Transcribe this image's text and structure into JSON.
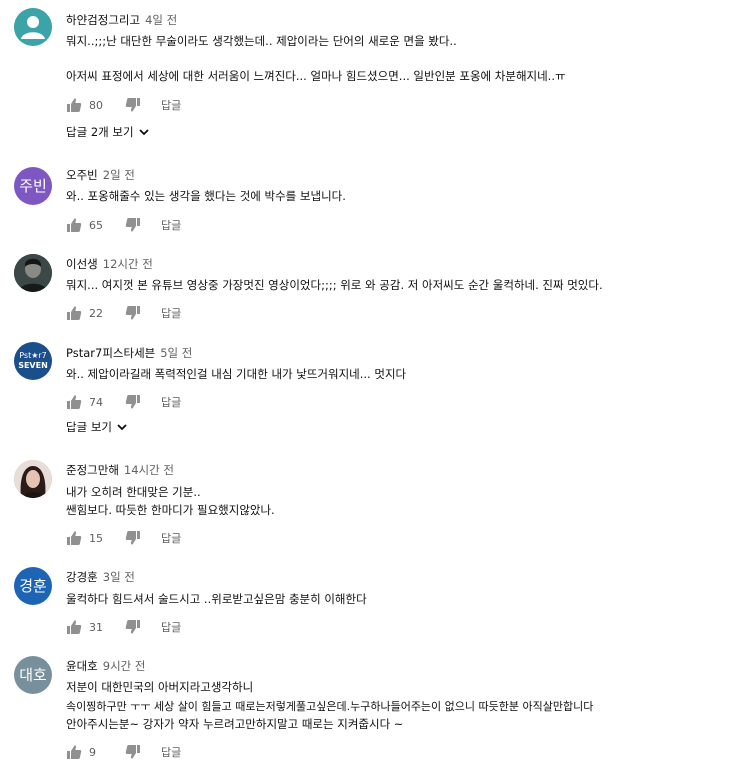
{
  "comments": [
    {
      "author": "하얀검정그리고",
      "time": "4일 전",
      "lines": [
        "뭐지..;;;난 대단한 무술이라도 생각했는데.. 제압이라는 단어의 새로운 면을 봤다..",
        "",
        "아저씨 표정에서 세상에 대한 서러움이 느껴진다... 얼마나 힘드셨으면... 일반인분 포옹에 차분해지네..ㅠ"
      ],
      "likes": "80",
      "reply_label": "답글",
      "view_replies": "답글 2개 보기",
      "avatar": {
        "type": "default",
        "color": "#3ca4a8"
      }
    },
    {
      "author": "오주빈",
      "time": "2일 전",
      "lines": [
        "와.. 포옹해줄수 있는 생각을 했다는 것에 박수를 보냅니다."
      ],
      "likes": "65",
      "reply_label": "답글",
      "avatar": {
        "type": "text",
        "text": "주빈",
        "color": "#7e57c2"
      }
    },
    {
      "author": "이선생",
      "time": "12시간 전",
      "lines": [
        "뭐지...   여지껏 본 유튜브 영상중 가장멋진 영상이었다;;;; 위로 와 공감. 저 아저씨도 순간 울컥하네. 진짜 멋있다."
      ],
      "likes": "22",
      "reply_label": "답글",
      "avatar": {
        "type": "photo",
        "color": "#2e3a3a"
      }
    },
    {
      "author": "Pstar7피스타세븐",
      "time": "5일 전",
      "lines": [
        "와.. 제압이라길래 폭력적인걸 내심 기대한 내가 낯뜨거워지네... 멋지다"
      ],
      "likes": "74",
      "reply_label": "답글",
      "view_replies": "답글 보기",
      "avatar": {
        "type": "logo",
        "top": "Pst★r7",
        "bottom": "SEVEN",
        "color": "#1b4f8c"
      }
    },
    {
      "author": "준정그만해",
      "time": "14시간 전",
      "lines": [
        "내가 오히려 한대맞은 기분..",
        "쌘힘보다. 따듯한 한마디가 필요했지않았나."
      ],
      "likes": "15",
      "reply_label": "답글",
      "avatar": {
        "type": "photo",
        "color": "#c9a79a"
      }
    },
    {
      "author": "강경훈",
      "time": "3일 전",
      "lines": [
        "울컥하다 힘드셔서 술드시고 ..위로받고싶은맘 충분히 이해한다"
      ],
      "likes": "31",
      "reply_label": "답글",
      "avatar": {
        "type": "text",
        "text": "경훈",
        "color": "#1e64b4"
      }
    },
    {
      "author": "윤대호",
      "time": "9시간 전",
      "lines": [
        "저분이 대한민국의 아버지라고생각하니",
        "속이찡하구만 ㅜㅜ 세상 살이 힘들고 때로는저렇게풀고싶은데.누구하나들어주는이 없으니 따듯한분 아직살만합니다",
        "안아주시는분~ 강자가 약자 누르려고만하지말고 때로는 지켜줍시다 ~"
      ],
      "likes": "9",
      "reply_label": "답글",
      "avatar": {
        "type": "text",
        "text": "대호",
        "color": "#78909c"
      }
    }
  ]
}
